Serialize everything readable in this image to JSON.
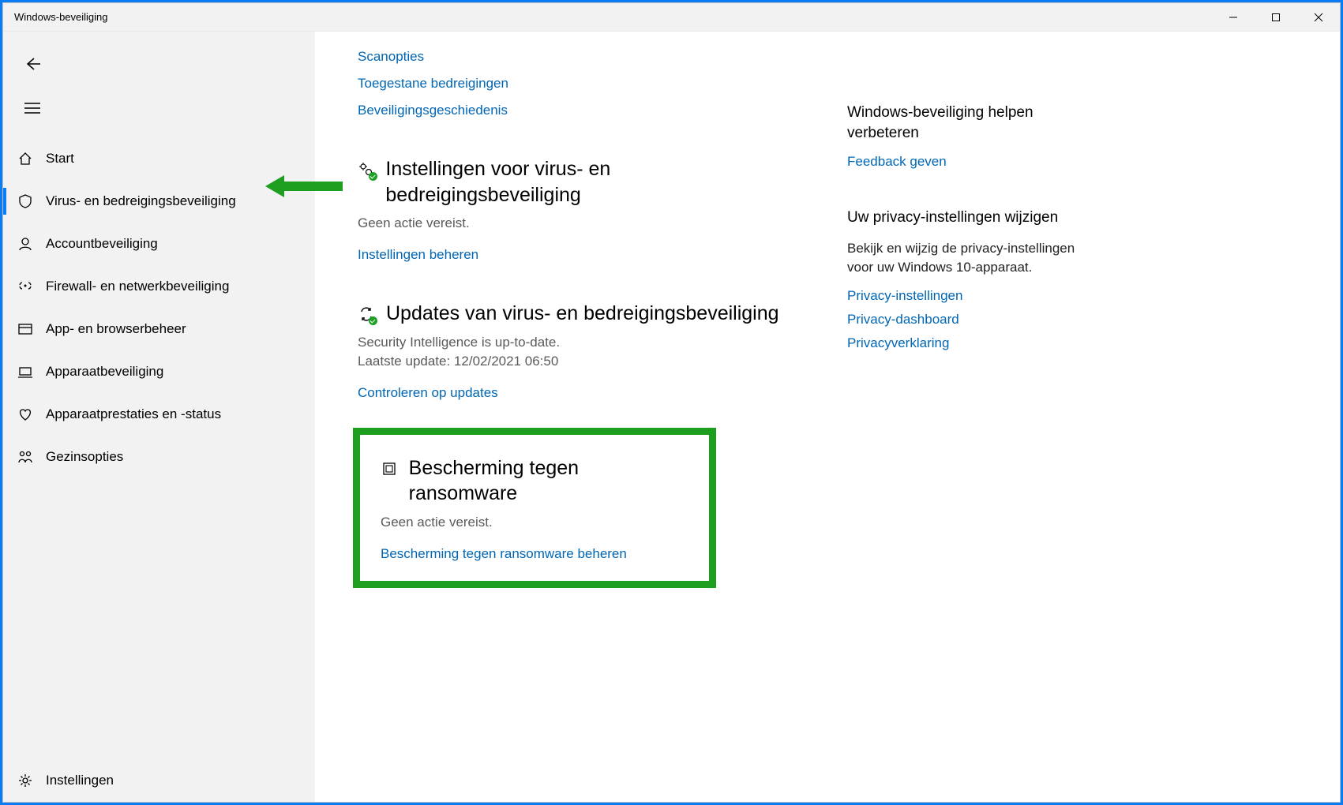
{
  "window": {
    "title": "Windows-beveiliging"
  },
  "sidebar": {
    "items": [
      {
        "label": "Start"
      },
      {
        "label": "Virus- en bedreigingsbeveiliging"
      },
      {
        "label": "Accountbeveiliging"
      },
      {
        "label": "Firewall- en netwerkbeveiliging"
      },
      {
        "label": "App- en browserbeheer"
      },
      {
        "label": "Apparaatbeveiliging"
      },
      {
        "label": "Apparaatprestaties en -status"
      },
      {
        "label": "Gezinsopties"
      }
    ],
    "settings": "Instellingen"
  },
  "main": {
    "topLinks": {
      "scan": "Scanopties",
      "allowed": "Toegestane bedreigingen",
      "history": "Beveiligingsgeschiedenis"
    },
    "settings": {
      "title": "Instellingen voor virus- en bedreigingsbeveiliging",
      "desc": "Geen actie vereist.",
      "link": "Instellingen beheren"
    },
    "updates": {
      "title": "Updates van virus- en bedreigingsbeveiliging",
      "desc1": "Security Intelligence is up-to-date.",
      "desc2": "Laatste update: 12/02/2021 06:50",
      "link": "Controleren op updates"
    },
    "ransomware": {
      "title": "Bescherming tegen ransomware",
      "desc": "Geen actie vereist.",
      "link": "Bescherming tegen ransomware beheren"
    }
  },
  "right": {
    "improve": {
      "title": "Windows-beveiliging helpen verbeteren",
      "link": "Feedback geven"
    },
    "privacy": {
      "title": "Uw privacy-instellingen wijzigen",
      "text": "Bekijk en wijzig de privacy-instellingen voor uw Windows 10-apparaat.",
      "link1": "Privacy-instellingen",
      "link2": "Privacy-dashboard",
      "link3": "Privacyverklaring"
    }
  }
}
